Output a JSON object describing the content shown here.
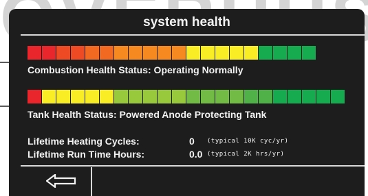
{
  "watermark": {
    "text": "OVERHUS"
  },
  "screen": {
    "title": "system health"
  },
  "combustion": {
    "status_text": "Combustion Health Status: Operating Normally",
    "segments": [
      "#e8262b",
      "#e8262b",
      "#ee4a24",
      "#ee4a24",
      "#f26a21",
      "#f26a21",
      "#f6891f",
      "#f6891f",
      "#f6891f",
      "#f6891f",
      "#f6891f",
      "#f9ed25",
      "#f9ed25",
      "#f9ed25",
      "#f9ed25",
      "#f9ed25",
      "#16ab4f",
      "#16ab4f",
      "#16ab4f",
      "#16ab4f"
    ]
  },
  "tank": {
    "status_text": "Tank Health Status: Powered Anode Protecting Tank",
    "segments": [
      "#e8262b",
      "#f9ed25",
      "#f9ed25",
      "#f9ed25",
      "#f9ed25",
      "#f9ed25",
      "#98c93c",
      "#98c93c",
      "#98c93c",
      "#98c93c",
      "#98c93c",
      "#72bb44",
      "#72bb44",
      "#72bb44",
      "#72bb44",
      "#4fb148",
      "#4fb148",
      "#16ab4f",
      "#16ab4f",
      "#16ab4f",
      "#16ab4f",
      "#16ab4f"
    ]
  },
  "stats": {
    "cycles_label": "Lifetime Heating Cycles:",
    "cycles_value": "0",
    "cycles_note": "(typical 10K cyc/yr)",
    "hours_label": "Lifetime Run Time Hours:",
    "hours_value": "0.0",
    "hours_note": "(typical 2K hrs/yr)"
  },
  "icons": {
    "back": "back-arrow-icon",
    "combustion_callout": "callout-arrow-icon",
    "tank_callout": "callout-arrow-icon"
  },
  "colors": {
    "screen_background": "#1d1d1d",
    "text": "#f2f2f2",
    "divider": "#d9d9d9",
    "callout_arrow": "#5a5a5a"
  }
}
